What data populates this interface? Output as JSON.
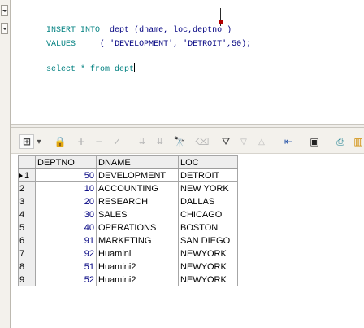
{
  "editor": {
    "line1": {
      "kw_insert": "INSERT INTO",
      "table": "dept",
      "cols": "(dname, loc,deptno )"
    },
    "line2": {
      "kw_values": "VALUES",
      "open": "(",
      "v1": "'DEVELOPMENT'",
      "comma1": ",",
      "v2": "'DETROIT'",
      "comma2": ",",
      "v3": "50",
      "close": ");"
    },
    "line3": {
      "text": "select * from dept"
    }
  },
  "toolbar": {
    "icons": [
      "grid-icon",
      "dropdown-icon",
      "lock-icon",
      "add-icon",
      "remove-icon",
      "check-icon",
      "double-down-icon",
      "double-down-icon",
      "binoculars-icon",
      "eraser-icon",
      "filter-icon",
      "sort-down-icon",
      "sort-up-icon",
      "export-icon",
      "save-icon",
      "print-icon",
      "chart-icon"
    ]
  },
  "grid": {
    "headers": [
      "DEPTNO",
      "DNAME",
      "LOC"
    ],
    "rows": [
      {
        "n": "1",
        "deptno": "50",
        "dname": "DEVELOPMENT",
        "loc": "DETROIT",
        "current": true
      },
      {
        "n": "2",
        "deptno": "10",
        "dname": "ACCOUNTING",
        "loc": "NEW YORK",
        "current": false
      },
      {
        "n": "3",
        "deptno": "20",
        "dname": "RESEARCH",
        "loc": "DALLAS",
        "current": false
      },
      {
        "n": "4",
        "deptno": "30",
        "dname": "SALES",
        "loc": "CHICAGO",
        "current": false
      },
      {
        "n": "5",
        "deptno": "40",
        "dname": "OPERATIONS",
        "loc": "BOSTON",
        "current": false
      },
      {
        "n": "6",
        "deptno": "91",
        "dname": "MARKETING",
        "loc": "SAN DIEGO",
        "current": false
      },
      {
        "n": "7",
        "deptno": "92",
        "dname": "Huamini",
        "loc": "NEWYORK",
        "current": false
      },
      {
        "n": "8",
        "deptno": "51",
        "dname": "Huamini2",
        "loc": "NEWYORK",
        "current": false
      },
      {
        "n": "9",
        "deptno": "52",
        "dname": "Huamini2",
        "loc": "NEWYORK",
        "current": false
      }
    ]
  }
}
